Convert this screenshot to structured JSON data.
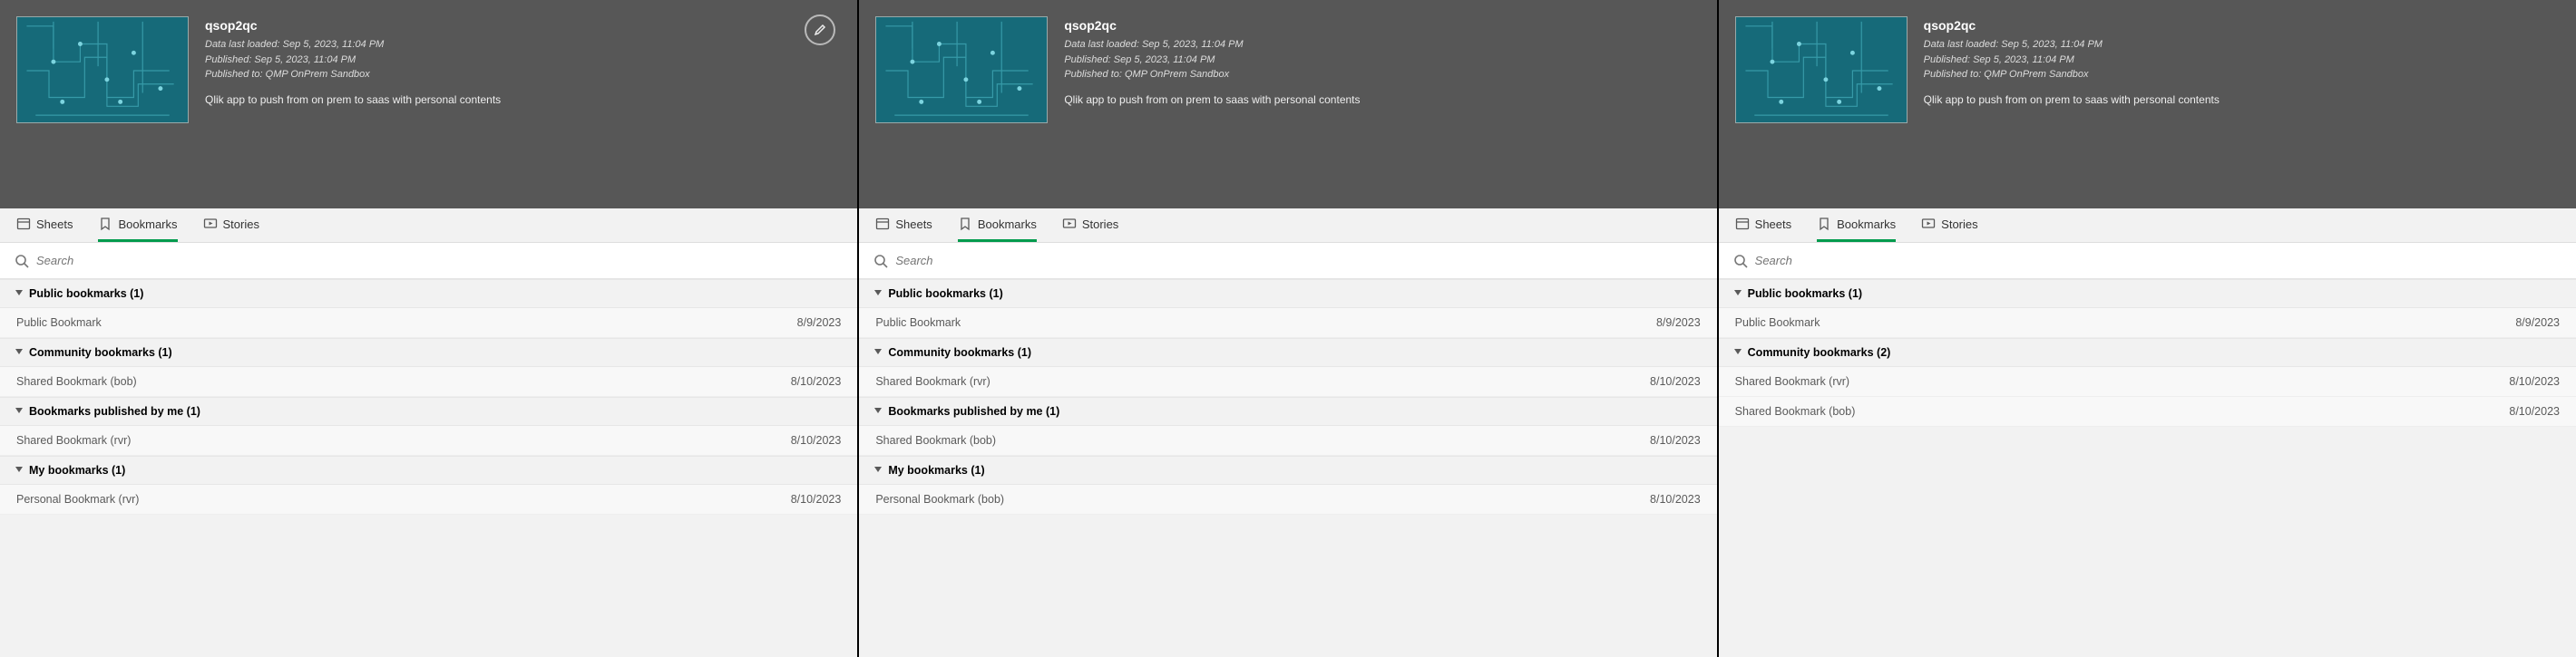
{
  "panels": [
    {
      "hasEdit": true,
      "app": {
        "title": "qsop2qc",
        "lastLoaded": "Data last loaded: Sep 5, 2023, 11:04 PM",
        "published": "Published: Sep 5, 2023, 11:04 PM",
        "publishedTo": "Published to: QMP OnPrem Sandbox",
        "desc": "Qlik app to push from on prem to saas with personal contents"
      },
      "tabs": {
        "sheets": "Sheets",
        "bookmarks": "Bookmarks",
        "stories": "Stories"
      },
      "search": {
        "placeholder": "Search"
      },
      "sections": [
        {
          "title": "Public bookmarks (1)",
          "items": [
            {
              "name": "Public Bookmark",
              "date": "8/9/2023"
            }
          ]
        },
        {
          "title": "Community bookmarks (1)",
          "items": [
            {
              "name": "Shared Bookmark (bob)",
              "date": "8/10/2023"
            }
          ]
        },
        {
          "title": "Bookmarks published by me (1)",
          "items": [
            {
              "name": "Shared Bookmark (rvr)",
              "date": "8/10/2023"
            }
          ]
        },
        {
          "title": "My bookmarks (1)",
          "items": [
            {
              "name": "Personal Bookmark (rvr)",
              "date": "8/10/2023"
            }
          ]
        }
      ]
    },
    {
      "hasEdit": false,
      "app": {
        "title": "qsop2qc",
        "lastLoaded": "Data last loaded: Sep 5, 2023, 11:04 PM",
        "published": "Published: Sep 5, 2023, 11:04 PM",
        "publishedTo": "Published to: QMP OnPrem Sandbox",
        "desc": "Qlik app to push from on prem to saas with personal contents"
      },
      "tabs": {
        "sheets": "Sheets",
        "bookmarks": "Bookmarks",
        "stories": "Stories"
      },
      "search": {
        "placeholder": "Search"
      },
      "sections": [
        {
          "title": "Public bookmarks (1)",
          "items": [
            {
              "name": "Public Bookmark",
              "date": "8/9/2023"
            }
          ]
        },
        {
          "title": "Community bookmarks (1)",
          "items": [
            {
              "name": "Shared Bookmark (rvr)",
              "date": "8/10/2023"
            }
          ]
        },
        {
          "title": "Bookmarks published by me (1)",
          "items": [
            {
              "name": "Shared Bookmark (bob)",
              "date": "8/10/2023"
            }
          ]
        },
        {
          "title": "My bookmarks (1)",
          "items": [
            {
              "name": "Personal Bookmark (bob)",
              "date": "8/10/2023"
            }
          ]
        }
      ]
    },
    {
      "hasEdit": false,
      "app": {
        "title": "qsop2qc",
        "lastLoaded": "Data last loaded: Sep 5, 2023, 11:04 PM",
        "published": "Published: Sep 5, 2023, 11:04 PM",
        "publishedTo": "Published to: QMP OnPrem Sandbox",
        "desc": "Qlik app to push from on prem to saas with personal contents"
      },
      "tabs": {
        "sheets": "Sheets",
        "bookmarks": "Bookmarks",
        "stories": "Stories"
      },
      "search": {
        "placeholder": "Search"
      },
      "sections": [
        {
          "title": "Public bookmarks (1)",
          "items": [
            {
              "name": "Public Bookmark",
              "date": "8/9/2023"
            }
          ]
        },
        {
          "title": "Community bookmarks (2)",
          "items": [
            {
              "name": "Shared Bookmark (rvr)",
              "date": "8/10/2023"
            },
            {
              "name": "Shared Bookmark (bob)",
              "date": "8/10/2023"
            }
          ]
        }
      ]
    }
  ]
}
